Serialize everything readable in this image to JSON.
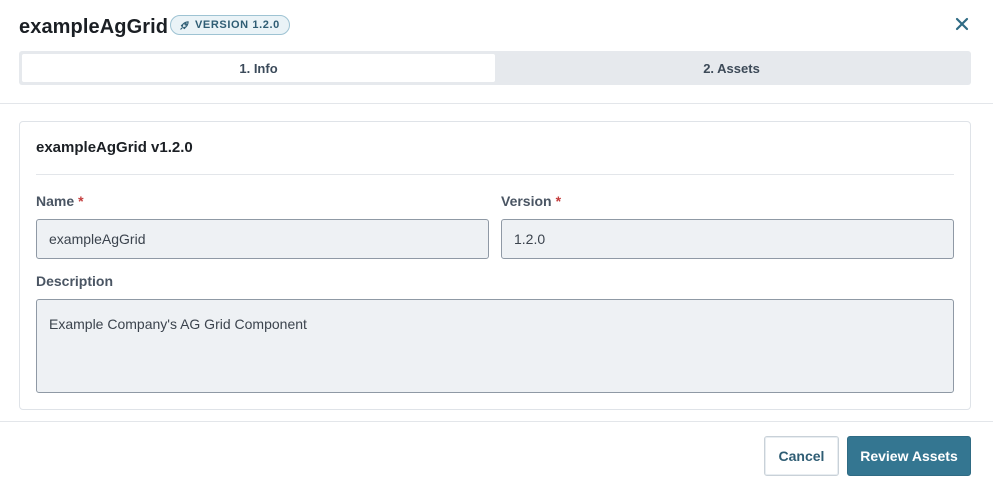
{
  "header": {
    "title": "exampleAgGrid",
    "version_badge": "VERSION 1.2.0",
    "badge_icon": "rocket-icon",
    "close_icon": "close-icon"
  },
  "steps": [
    {
      "label": "1. Info",
      "active": true
    },
    {
      "label": "2. Assets",
      "active": false
    }
  ],
  "card": {
    "title": "exampleAgGrid v1.2.0",
    "fields": {
      "name": {
        "label": "Name",
        "required_mark": "*",
        "value": "exampleAgGrid"
      },
      "version": {
        "label": "Version",
        "required_mark": "*",
        "value": "1.2.0"
      },
      "description": {
        "label": "Description",
        "value": "Example Company's AG Grid Component"
      }
    }
  },
  "footer": {
    "cancel_label": "Cancel",
    "primary_label": "Review Assets"
  },
  "colors": {
    "accent": "#347691",
    "badge_border": "#9ec3d3",
    "badge_bg": "#eaf3f7",
    "required": "#c43c3c"
  }
}
